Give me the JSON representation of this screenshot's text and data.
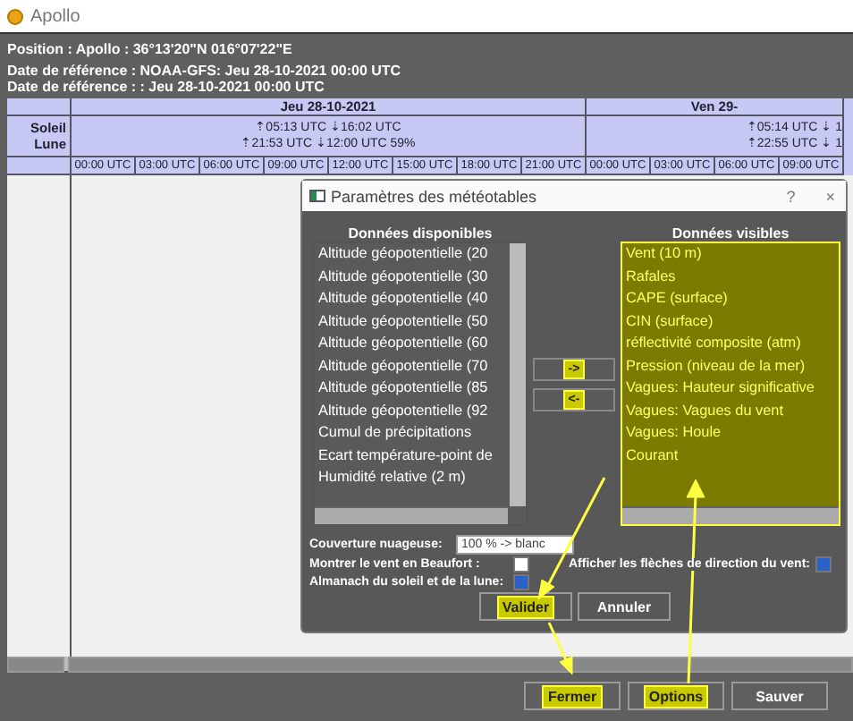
{
  "window": {
    "title": "Apollo"
  },
  "info": [
    "Position : Apollo : 36°13'20\"N 016°07'22\"E",
    "Date de référence : NOAA-GFS: Jeu 28-10-2021 00:00 UTC",
    "Date de référence : : Jeu 28-10-2021 00:00 UTC"
  ],
  "table": {
    "row_labels": [
      "Soleil",
      "Lune"
    ],
    "days": [
      {
        "label": "Jeu 28-10-2021",
        "sun": "⇡05:13 UTC ⇣16:02 UTC",
        "moon": "⇡21:53 UTC ⇣12:00 UTC  59%",
        "times": [
          "00:00 UTC",
          "03:00 UTC",
          "06:00 UTC",
          "09:00 UTC",
          "12:00 UTC",
          "15:00 UTC",
          "18:00 UTC",
          "21:00 UTC"
        ]
      },
      {
        "label": "Ven 29-",
        "sun": "⇡05:14 UTC ⇣ 1",
        "moon": "⇡22:55 UTC ⇣ 1",
        "times": [
          "00:00 UTC",
          "03:00 UTC",
          "06:00 UTC",
          "09:00 UTC"
        ]
      }
    ]
  },
  "dialog": {
    "title": "Paramètres des météotables",
    "help": "?",
    "close": "×",
    "available": {
      "header": "Données disponibles",
      "items": [
        "Altitude géopotentielle (20",
        "Altitude géopotentielle (30",
        "Altitude géopotentielle (40",
        "Altitude géopotentielle (50",
        "Altitude géopotentielle (60",
        "Altitude géopotentielle (70",
        "Altitude géopotentielle (85",
        "Altitude géopotentielle (92",
        "Cumul de précipitations",
        "Ecart température-point de",
        "Humidité relative (2 m)"
      ]
    },
    "move_buttons": [
      {
        "label": "->",
        "highlighted": true
      },
      {
        "label": "<-",
        "highlighted": true
      }
    ],
    "visible": {
      "header": "Données visibles",
      "highlighted": true,
      "items": [
        "Vent (10 m)",
        "Rafales",
        "CAPE (surface)",
        "CIN (surface)",
        "réflectivité composite (atm)",
        "Pression (niveau de la mer)",
        "Vagues: Hauteur significative",
        "Vagues: Vagues du vent",
        "Vagues: Houle",
        "Courant"
      ]
    },
    "cloud": {
      "label": "Couverture nuageuse:",
      "value": "100 % -> blanc"
    },
    "checks": [
      {
        "label": "Montrer le vent en Beaufort :",
        "checked": false
      },
      {
        "label": "Afficher les flèches de direction du vent:",
        "checked": true
      },
      {
        "label": "Almanach du soleil et de la lune:",
        "checked": true
      }
    ],
    "buttons": [
      {
        "label": "Valider",
        "highlighted": true
      },
      {
        "label": "Annuler",
        "highlighted": false
      }
    ]
  },
  "footer_buttons": [
    {
      "label": "Fermer",
      "highlighted": true
    },
    {
      "label": "Options",
      "highlighted": true
    },
    {
      "label": "Sauver",
      "highlighted": false
    }
  ]
}
